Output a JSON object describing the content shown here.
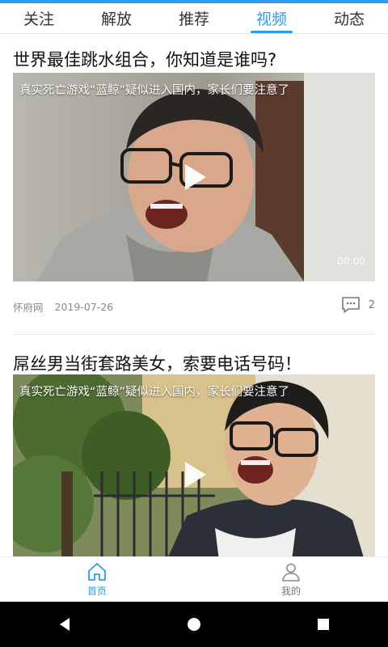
{
  "tabs": [
    {
      "label": "关注",
      "active": false
    },
    {
      "label": "解放",
      "active": false
    },
    {
      "label": "推荐",
      "active": false
    },
    {
      "label": "视频",
      "active": true
    },
    {
      "label": "动态",
      "active": false
    }
  ],
  "feed": [
    {
      "title": "世界最佳跳水组合，你知道是谁吗?",
      "video_overlay_title": "真实死亡游戏“蓝鲸”疑似进入国内，家长们要注意了",
      "duration": "00:00",
      "source": "怀府网",
      "date": "2019-07-26",
      "comment_count": "2"
    },
    {
      "title": "屌丝男当街套路美女，索要电话号码！",
      "video_overlay_title": "真实死亡游戏“蓝鲸”疑似进入国内，家长们要注意了"
    }
  ],
  "bottom_nav": [
    {
      "label": "首页",
      "icon": "home-icon",
      "active": true
    },
    {
      "label": "我的",
      "icon": "user-icon",
      "active": false
    }
  ],
  "colors": {
    "accent": "#2d9bf0",
    "text_primary": "#111111",
    "text_meta": "#8a8a8a"
  }
}
